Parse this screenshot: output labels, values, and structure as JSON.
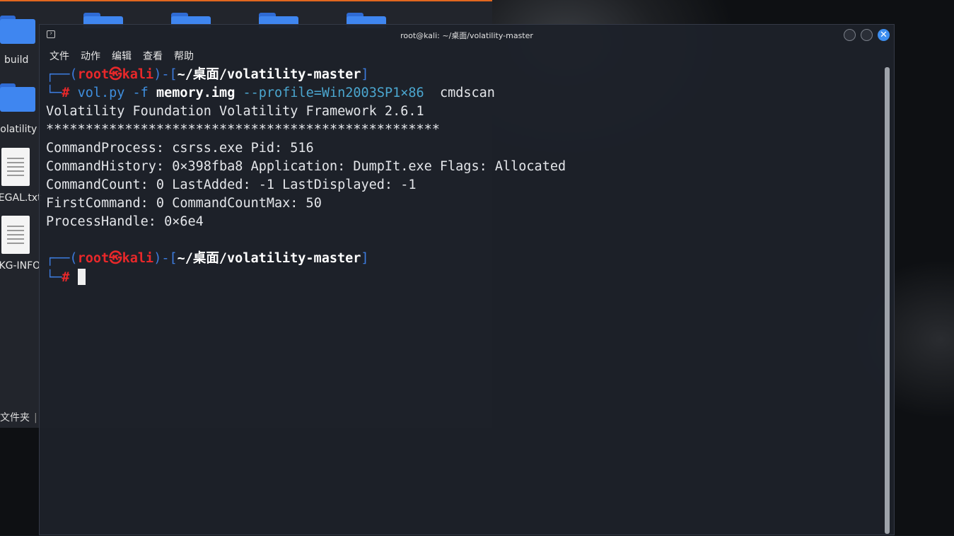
{
  "file_manager": {
    "items": [
      {
        "label": "build",
        "kind": "folder"
      },
      {
        "label": "volatility",
        "kind": "folder"
      },
      {
        "label": "LEGAL.txt",
        "kind": "file"
      },
      {
        "label": "PKG-INFO",
        "kind": "file"
      }
    ],
    "status_text": "文件夹",
    "status_separator": "|"
  },
  "terminal": {
    "window_title": "root@kali: ~/桌面/volatility-master",
    "menu": [
      "文件",
      "动作",
      "编辑",
      "查看",
      "帮助"
    ],
    "prompt": {
      "frame_open": "┌──(",
      "user": "root",
      "at_symbol": "㉿",
      "host": "kali",
      "frame_mid": ")-[",
      "path": "~/桌面/volatility-master",
      "frame_close": "]",
      "frame_lower": "└─",
      "hash": "#"
    },
    "command": {
      "program": "vol.py",
      "flag": "-f",
      "file": "memory.img",
      "profile": "--profile=Win2003SP1×86",
      "plugin": "cmdscan"
    },
    "output": [
      "Volatility Foundation Volatility Framework 2.6.1",
      "**************************************************",
      "CommandProcess: csrss.exe Pid: 516",
      "CommandHistory: 0×398fba8 Application: DumpIt.exe Flags: Allocated",
      "CommandCount: 0 LastAdded: -1 LastDisplayed: -1",
      "FirstCommand: 0 CommandCountMax: 50",
      "ProcessHandle: 0×6e4"
    ],
    "close_glyph": "✕"
  },
  "colors": {
    "terminal_bg": "#1d212a",
    "prompt_frame": "#3c7bdd",
    "prompt_user": "#e8282a",
    "close_button": "#3d8ef0",
    "folder": "#3f86f0"
  }
}
